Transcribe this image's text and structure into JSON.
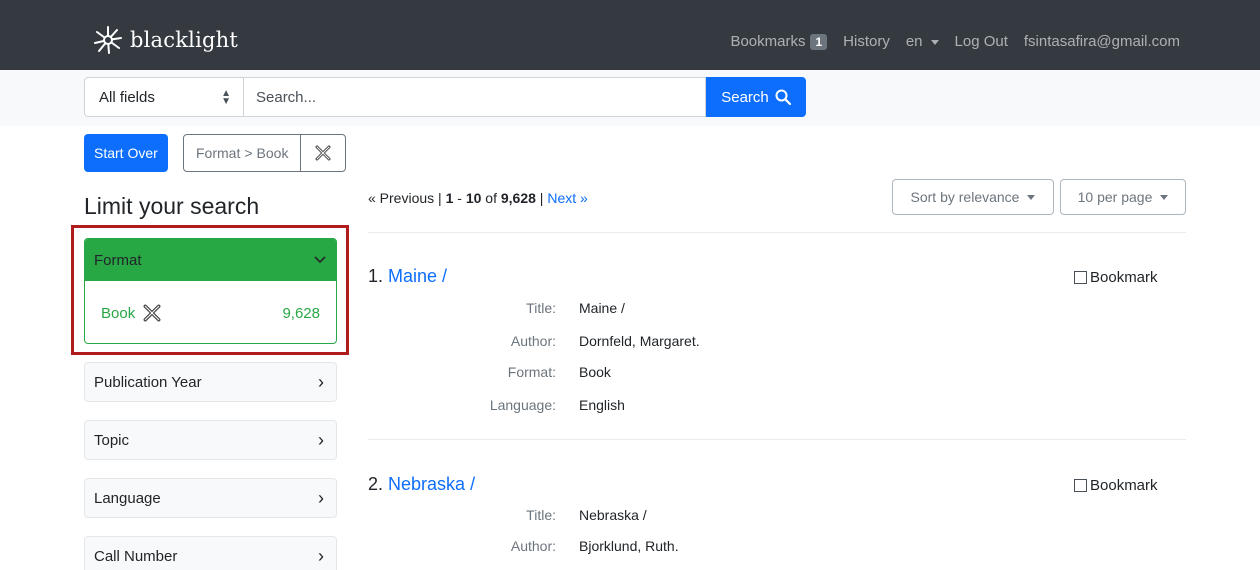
{
  "navbar": {
    "brand": "blacklight",
    "bookmarks_label": "Bookmarks",
    "bookmarks_count": "1",
    "history_label": "History",
    "language": "en",
    "logout_label": "Log Out",
    "user_email": "fsintasafira@gmail.com"
  },
  "search": {
    "field_selected": "All fields",
    "placeholder": "Search...",
    "button_label": "Search"
  },
  "constraints": {
    "start_over_label": "Start Over",
    "field": "Format",
    "separator": ">",
    "value": "Book"
  },
  "sidebar": {
    "title": "Limit your search",
    "format_facet": {
      "label": "Format",
      "selected_value": "Book",
      "selected_count": "9,628"
    },
    "facets": [
      {
        "label": "Publication Year"
      },
      {
        "label": "Topic"
      },
      {
        "label": "Language"
      },
      {
        "label": "Call Number"
      }
    ]
  },
  "pagination": {
    "previous_label": "« Previous",
    "range_start": "1",
    "range_end": "10",
    "total": "9,628",
    "next_label": "Next »"
  },
  "controls": {
    "sort_label": "Sort by relevance",
    "per_page_label": "10 per page"
  },
  "results": [
    {
      "index": "1.",
      "title_link": "Maine /",
      "bookmark_label": "Bookmark",
      "fields": [
        {
          "label": "Title:",
          "value": "Maine /"
        },
        {
          "label": "Author:",
          "value": "Dornfeld, Margaret."
        },
        {
          "label": "Format:",
          "value": "Book"
        },
        {
          "label": "Language:",
          "value": "English"
        }
      ]
    },
    {
      "index": "2.",
      "title_link": "Nebraska /",
      "bookmark_label": "Bookmark",
      "fields": [
        {
          "label": "Title:",
          "value": "Nebraska /"
        },
        {
          "label": "Author:",
          "value": "Bjorklund, Ruth."
        }
      ]
    }
  ],
  "colors": {
    "navbar_bg": "#343a40",
    "primary": "#0d6efd",
    "facet_active": "#28a745",
    "highlight": "#b01c1c"
  }
}
